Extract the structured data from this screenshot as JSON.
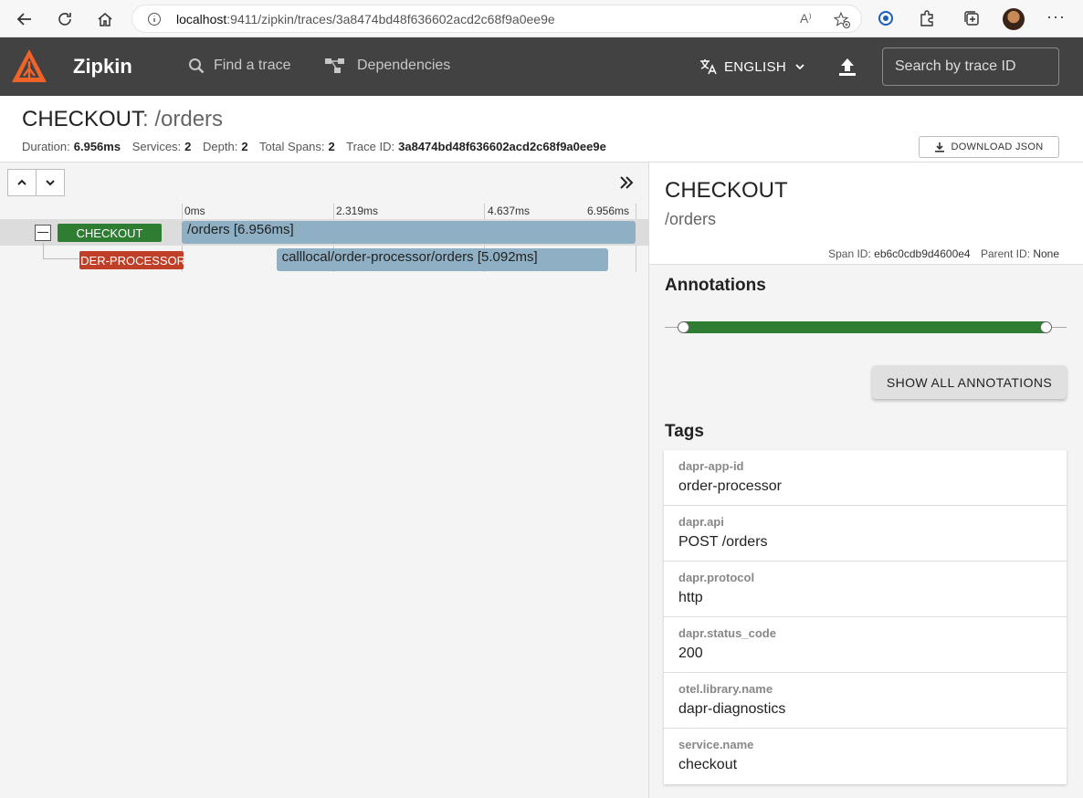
{
  "browser": {
    "url_host": "localhost",
    "url_path": ":9411/zipkin/traces/3a8474bd48f636602acd2c68f9a0ee9e",
    "read_aloud_label": "A⁾",
    "more_label": "···"
  },
  "header": {
    "brand": "Zipkin",
    "find_trace": "Find a trace",
    "dependencies": "Dependencies",
    "language": "ENGLISH",
    "search_placeholder": "Search by trace ID"
  },
  "trace": {
    "service": "CHECKOUT",
    "span_name": ": /orders",
    "duration_label": "Duration:",
    "duration": "6.956ms",
    "services_label": "Services:",
    "services": "2",
    "depth_label": "Depth:",
    "depth": "2",
    "total_spans_label": "Total Spans:",
    "total_spans": "2",
    "trace_id_label": "Trace ID:",
    "trace_id": "3a8474bd48f636602acd2c68f9a0ee9e",
    "download_label": "DOWNLOAD JSON"
  },
  "timeline": {
    "ticks": [
      "0ms",
      "2.319ms",
      "4.637ms",
      "6.956ms"
    ],
    "spans": [
      {
        "service": "CHECKOUT",
        "label": "/orders [6.956ms]",
        "color": "#2e7d32",
        "start_ms": 0,
        "duration_ms": 6.956
      },
      {
        "service": "ORDER-PROCESSOR",
        "label": "calllocal/order-processor/orders [5.092ms]",
        "color": "#bf3f28",
        "start_ms": 1.45,
        "duration_ms": 5.092
      }
    ]
  },
  "detail": {
    "service": "CHECKOUT",
    "span": "/orders",
    "span_id_label": "Span ID:",
    "span_id": "eb6c0cdb9d4600e4",
    "parent_id_label": "Parent ID:",
    "parent_id": "None",
    "annotations_title": "Annotations",
    "show_all_label": "SHOW ALL ANNOTATIONS",
    "tags_title": "Tags",
    "tags": [
      {
        "key": "dapr-app-id",
        "value": "order-processor"
      },
      {
        "key": "dapr.api",
        "value": "POST /orders"
      },
      {
        "key": "dapr.protocol",
        "value": "http"
      },
      {
        "key": "dapr.status_code",
        "value": "200"
      },
      {
        "key": "otel.library.name",
        "value": "dapr-diagnostics"
      },
      {
        "key": "service.name",
        "value": "checkout"
      }
    ]
  }
}
